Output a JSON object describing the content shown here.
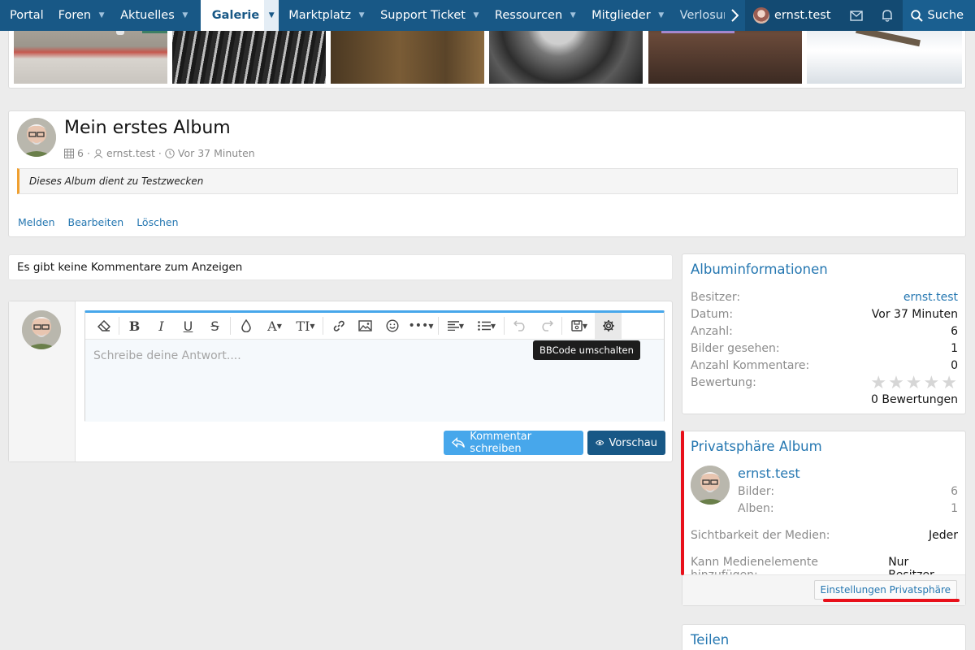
{
  "nav": {
    "items": [
      {
        "label": "Portal",
        "caret": false
      },
      {
        "label": "Foren",
        "caret": true
      },
      {
        "label": "Aktuelles",
        "caret": true
      },
      {
        "label": "Galerie",
        "caret": true,
        "active": true
      },
      {
        "label": "Marktplatz",
        "caret": true
      },
      {
        "label": "Support Ticket",
        "caret": true
      },
      {
        "label": "Ressourcen",
        "caret": true
      },
      {
        "label": "Mitglieder",
        "caret": true
      },
      {
        "label": "Verlosunge",
        "caret": false
      }
    ],
    "user": "ernst.test",
    "search": "Suche"
  },
  "album": {
    "title": "Mein erstes Album",
    "count": "6",
    "author": "ernst.test",
    "time": "Vor 37 Minuten",
    "description": "Dieses Album dient zu Testzwecken",
    "actions": [
      "Melden",
      "Bearbeiten",
      "Löschen"
    ]
  },
  "comments": {
    "empty": "Es gibt keine Kommentare zum Anzeigen"
  },
  "editor": {
    "placeholder": "Schreibe deine Antwort....",
    "tooltip": "BBCode umschalten",
    "submit": "Kommentar schreiben",
    "preview": "Vorschau"
  },
  "info": {
    "title": "Albuminformationen",
    "rows": [
      {
        "label": "Besitzer:",
        "value": "ernst.test"
      },
      {
        "label": "Datum:",
        "value": "Vor 37 Minuten"
      },
      {
        "label": "Anzahl:",
        "value": "6"
      },
      {
        "label": "Bilder gesehen:",
        "value": "1"
      },
      {
        "label": "Anzahl Kommentare:",
        "value": "0"
      },
      {
        "label": "Bewertung:",
        "value": ""
      }
    ],
    "rating_count": "0 Bewertungen",
    "rating_stars": 0
  },
  "privacy": {
    "title": "Privatsphäre Album",
    "user": "ernst.test",
    "images_label": "Bilder:",
    "images": "6",
    "albums_label": "Alben:",
    "albums": "1",
    "visibility_label": "Sichtbarkeit der Medien:",
    "visibility": "Jeder",
    "add_label": "Kann Medienelemente hinzufügen:",
    "add": "Nur Besitzer",
    "settings_button": "Einstellungen Privatsphäre"
  },
  "share": {
    "title": "Teilen"
  },
  "colors": {
    "nav_bg": "#185886",
    "link": "#2577b1",
    "accent": "#47a7eb",
    "annotation": "#e8101a"
  }
}
